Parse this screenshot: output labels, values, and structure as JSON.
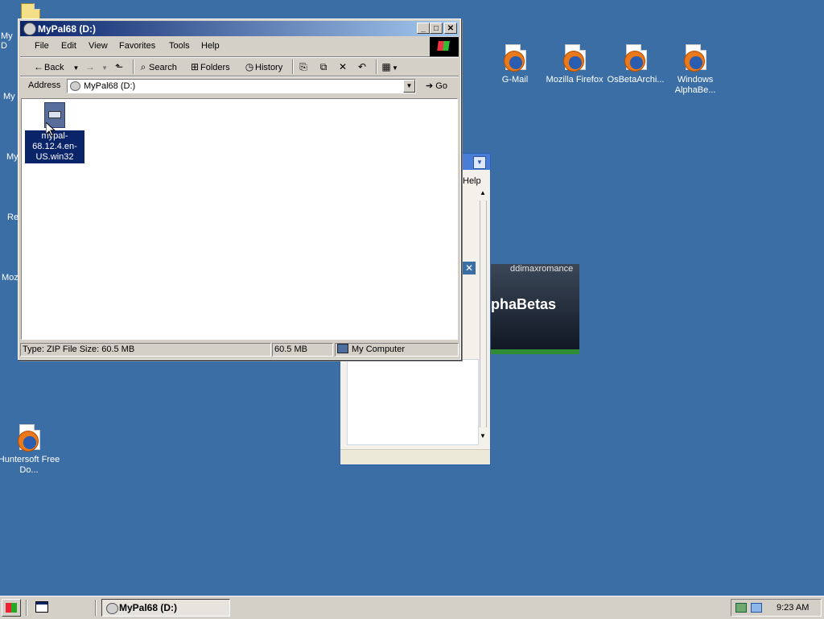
{
  "desktop": {
    "left_icons": [
      {
        "label": "My D"
      },
      {
        "label": "My"
      },
      {
        "label": "My"
      },
      {
        "label": "Re"
      },
      {
        "label": "Moz"
      }
    ],
    "icons": [
      {
        "label": "G-Mail"
      },
      {
        "label": "Mozilla Firefox"
      },
      {
        "label": "OsBetaArchi..."
      },
      {
        "label": "Windows AlphaBe..."
      },
      {
        "label": "Huntersoft Free Do..."
      }
    ]
  },
  "background_window": {
    "menu_fragment": "Help",
    "album_caption": "ddimaxromance",
    "album_text": "phaBetas"
  },
  "window": {
    "title": "MyPal68 (D:)",
    "menu": [
      "File",
      "Edit",
      "View",
      "Favorites",
      "Tools",
      "Help"
    ],
    "toolbar": {
      "back": "Back",
      "search": "Search",
      "folders": "Folders",
      "history": "History"
    },
    "address": {
      "label": "Address",
      "value": "MyPal68 (D:)",
      "go": "Go"
    },
    "files": [
      {
        "name": "mypal-68.12.4.en-US.win32",
        "selected": true
      }
    ],
    "status": {
      "info": "Type: ZIP File Size: 60.5 MB",
      "size": "60.5 MB",
      "zone": "My Computer"
    }
  },
  "taskbar": {
    "task_label": "MyPal68 (D:)",
    "clock": "9:23 AM"
  },
  "colors": {
    "desktop": "#3a6ea5",
    "titlebar_start": "#0a246a",
    "titlebar_end": "#a6caf0",
    "selection": "#0a246a",
    "chrome": "#d4d0c8"
  }
}
